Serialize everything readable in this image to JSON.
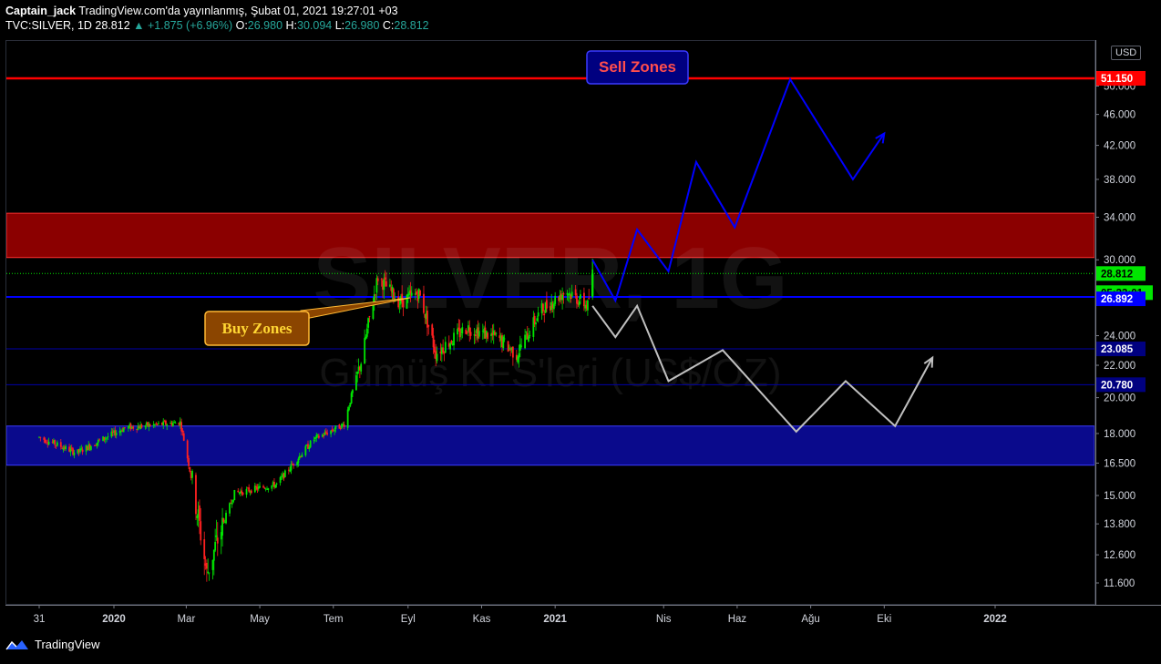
{
  "header": {
    "author": "Captain_jack",
    "published": "TradingView.com'da yayınlanmış, Şubat 01, 2021 19:27:01 +03",
    "symbol": "TVC:SILVER, 1D",
    "last": "28.812",
    "change": "▲ +1.875 (+6.96%)",
    "o_label": "O:",
    "o_value": "26.980",
    "h_label": "H:",
    "h_value": "30.094",
    "l_label": "L:",
    "l_value": "26.980",
    "c_label": "C:",
    "c_value": "28.812"
  },
  "currency": "USD",
  "watermark": {
    "symbol": "SILVER, 1G",
    "name": "Gümüş KFS'leri (US$/OZ)"
  },
  "annotations": {
    "sell": "Sell Zones",
    "buy": "Buy Zones"
  },
  "footer": {
    "brand": "TradingView"
  },
  "chart_data": {
    "type": "candlestick",
    "title": "SILVER, 1G",
    "subtitle": "Gümüş KFS'leri (US$/OZ)",
    "currency": "USD",
    "y_scale": "log",
    "ylim": [
      11.0,
      54.0
    ],
    "y_ticks": [
      11.6,
      12.6,
      13.8,
      15.0,
      16.5,
      18.0,
      20.0,
      22.0,
      24.0,
      30.0,
      34.0,
      38.0,
      42.0,
      46.0,
      50.0
    ],
    "y_tick_labels": [
      "11.600",
      "12.600",
      "13.800",
      "15.000",
      "16.500",
      "18.000",
      "20.000",
      "22.000",
      "24.000",
      "30.000",
      "34.000",
      "38.000",
      "42.000",
      "46.000",
      "50.000"
    ],
    "x_ticks": [
      {
        "label": "31",
        "date": "2019-10-31"
      },
      {
        "label": "2020",
        "date": "2020-01-01"
      },
      {
        "label": "Mar",
        "date": "2020-03-01"
      },
      {
        "label": "May",
        "date": "2020-05-01"
      },
      {
        "label": "Tem",
        "date": "2020-07-01"
      },
      {
        "label": "Eyl",
        "date": "2020-09-01"
      },
      {
        "label": "Kas",
        "date": "2020-11-01"
      },
      {
        "label": "2021",
        "date": "2021-01-01"
      },
      {
        "label": "Nis",
        "date": "2021-04-01"
      },
      {
        "label": "Haz",
        "date": "2021-06-01"
      },
      {
        "label": "Ağu",
        "date": "2021-08-01"
      },
      {
        "label": "Eki",
        "date": "2021-10-01"
      },
      {
        "label": "2022",
        "date": "2022-01-01"
      }
    ],
    "price_labels": [
      {
        "value": "51.150",
        "color": "#ff0000"
      },
      {
        "value": "28.812",
        "color": "#00e600"
      },
      {
        "value": "05:33:01",
        "color": "#00e600"
      },
      {
        "value": "26.892",
        "color": "#0000ff"
      },
      {
        "value": "23.085",
        "color": "#000080"
      },
      {
        "value": "20.780",
        "color": "#000080"
      }
    ],
    "horizontal_lines": [
      {
        "price": 51.15,
        "color": "#ff0000"
      },
      {
        "price": 26.892,
        "color": "#0000ff"
      },
      {
        "price": 23.085,
        "color": "#0000aa"
      },
      {
        "price": 20.78,
        "color": "#0000aa"
      },
      {
        "price": 28.812,
        "color": "#00e600",
        "style": "dotted"
      }
    ],
    "zones": [
      {
        "name": "Sell Zones",
        "from": 30.2,
        "to": 34.4,
        "color": "#8b0000"
      },
      {
        "name": "Buy Zones",
        "from": 16.4,
        "to": 18.4,
        "color": "#0a0a8c"
      }
    ],
    "series": [
      {
        "name": "SILVER",
        "key_points": [
          {
            "date": "2019-10-31",
            "value": 17.8
          },
          {
            "date": "2019-12-01",
            "value": 17.0
          },
          {
            "date": "2020-01-10",
            "value": 18.3
          },
          {
            "date": "2020-02-25",
            "value": 18.6
          },
          {
            "date": "2020-03-18",
            "value": 11.9
          },
          {
            "date": "2020-04-10",
            "value": 15.1
          },
          {
            "date": "2020-05-15",
            "value": 15.5
          },
          {
            "date": "2020-06-15",
            "value": 17.7
          },
          {
            "date": "2020-07-10",
            "value": 18.5
          },
          {
            "date": "2020-07-25",
            "value": 22.5
          },
          {
            "date": "2020-08-07",
            "value": 28.5
          },
          {
            "date": "2020-08-25",
            "value": 26.5
          },
          {
            "date": "2020-09-10",
            "value": 27.2
          },
          {
            "date": "2020-09-24",
            "value": 22.8
          },
          {
            "date": "2020-10-20",
            "value": 24.6
          },
          {
            "date": "2020-11-15",
            "value": 23.8
          },
          {
            "date": "2020-11-30",
            "value": 22.7
          },
          {
            "date": "2020-12-20",
            "value": 25.8
          },
          {
            "date": "2021-01-10",
            "value": 27.4
          },
          {
            "date": "2021-01-28",
            "value": 26.2
          },
          {
            "date": "2021-02-01",
            "value": 28.8
          }
        ]
      },
      {
        "name": "",
        "color": "#0000ff",
        "points": [
          {
            "date": "2021-02-01",
            "value": 30.0
          },
          {
            "date": "2021-02-20",
            "value": 26.6
          },
          {
            "date": "2021-03-10",
            "value": 32.8
          },
          {
            "date": "2021-04-05",
            "value": 29.0
          },
          {
            "date": "2021-04-28",
            "value": 40.0
          },
          {
            "date": "2021-05-30",
            "value": 33.0
          },
          {
            "date": "2021-07-15",
            "value": 51.0
          },
          {
            "date": "2021-09-05",
            "value": 38.0
          },
          {
            "date": "2021-10-01",
            "value": 43.5
          }
        ]
      },
      {
        "name": "",
        "color": "#c0c0c0",
        "points": [
          {
            "date": "2021-02-01",
            "value": 26.2
          },
          {
            "date": "2021-02-20",
            "value": 23.9
          },
          {
            "date": "2021-03-10",
            "value": 26.2
          },
          {
            "date": "2021-04-05",
            "value": 21.0
          },
          {
            "date": "2021-05-20",
            "value": 23.0
          },
          {
            "date": "2021-07-20",
            "value": 18.1
          },
          {
            "date": "2021-08-30",
            "value": 21.0
          },
          {
            "date": "2021-10-10",
            "value": 18.4
          },
          {
            "date": "2021-11-10",
            "value": 22.5
          }
        ]
      }
    ]
  },
  "colors": {
    "up": "#26a69a",
    "down": "#ef5350",
    "bg": "#000000",
    "grid": "#2a2e39"
  }
}
